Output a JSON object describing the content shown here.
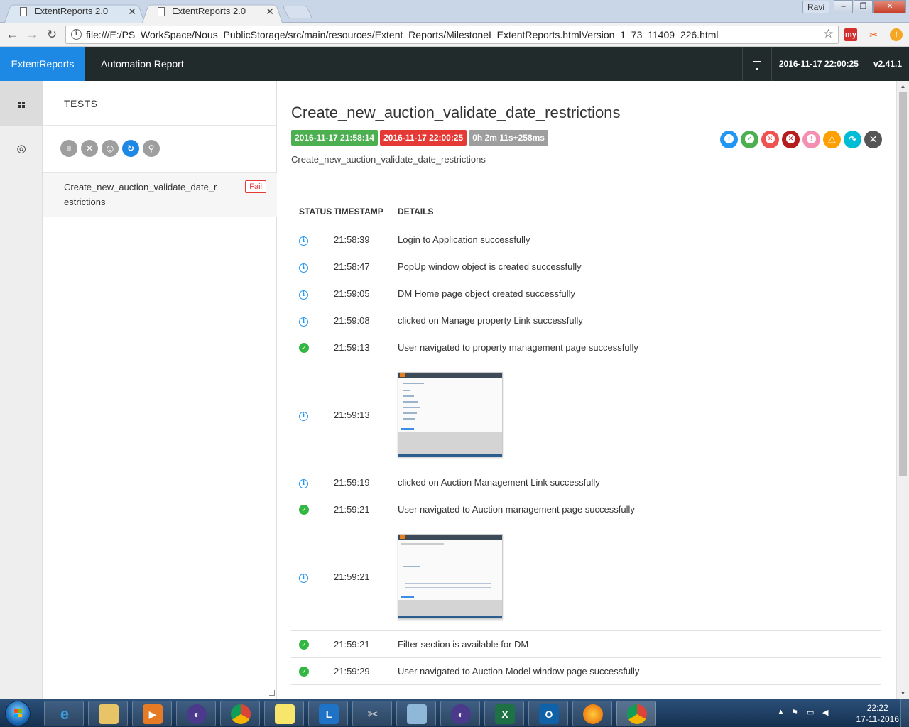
{
  "browser": {
    "tabs": [
      {
        "title": "ExtentReports 2.0",
        "active": false
      },
      {
        "title": "ExtentReports 2.0",
        "active": true
      }
    ],
    "user_chip": "Ravi",
    "url": "file:///E:/PS_WorkSpace/Nous_PublicStorage/src/main/resources/Extent_Reports/MilestoneI_ExtentReports.htmlVersion_1_73_11409_226.html",
    "ext_my_label": "my"
  },
  "navbar": {
    "brand": "ExtentReports",
    "title": "Automation Report",
    "datetime": "2016-11-17 22:00:25",
    "version": "v2.41.1"
  },
  "tests_panel": {
    "header": "TESTS",
    "test_name": "Create_new_auction_validate_date_restrictions",
    "test_status": "Fail"
  },
  "test": {
    "title": "Create_new_auction_validate_date_restrictions",
    "start_time": "2016-11-17 21:58:14",
    "end_time": "2016-11-17 22:00:25",
    "duration": "0h 2m 11s+258ms",
    "description": "Create_new_auction_validate_date_restrictions"
  },
  "log": {
    "headers": {
      "status": "STATUS",
      "timestamp": "TIMESTAMP",
      "details": "DETAILS"
    },
    "rows": [
      {
        "status": "info",
        "timestamp": "21:58:39",
        "details": "Login to Application successfully"
      },
      {
        "status": "info",
        "timestamp": "21:58:47",
        "details": "PopUp window object is created successfully"
      },
      {
        "status": "info",
        "timestamp": "21:59:05",
        "details": "DM Home page object created successfully"
      },
      {
        "status": "info",
        "timestamp": "21:59:08",
        "details": "clicked on Manage property Link successfully"
      },
      {
        "status": "pass",
        "timestamp": "21:59:13",
        "details": "User navigated to property management page successfully"
      },
      {
        "status": "info",
        "timestamp": "21:59:13",
        "details": "",
        "screenshot": "property-management-screenshot"
      },
      {
        "status": "info",
        "timestamp": "21:59:19",
        "details": "clicked on Auction Management Link successfully"
      },
      {
        "status": "pass",
        "timestamp": "21:59:21",
        "details": "User navigated to Auction management page successfully"
      },
      {
        "status": "info",
        "timestamp": "21:59:21",
        "details": "",
        "screenshot": "auction-management-screenshot"
      },
      {
        "status": "pass",
        "timestamp": "21:59:21",
        "details": "Filter section is available for DM"
      },
      {
        "status": "pass",
        "timestamp": "21:59:29",
        "details": "User navigated to Auction Model window page successfully"
      }
    ]
  },
  "taskbar": {
    "time": "22:22",
    "date": "17-11-2016"
  },
  "colors": {
    "brand_blue": "#1e88e5",
    "navbar_dark": "#222b2c",
    "pass_green": "#32b742",
    "fail_red": "#e53935",
    "info_blue": "#2196f3",
    "duration_gray": "#9e9e9e"
  }
}
